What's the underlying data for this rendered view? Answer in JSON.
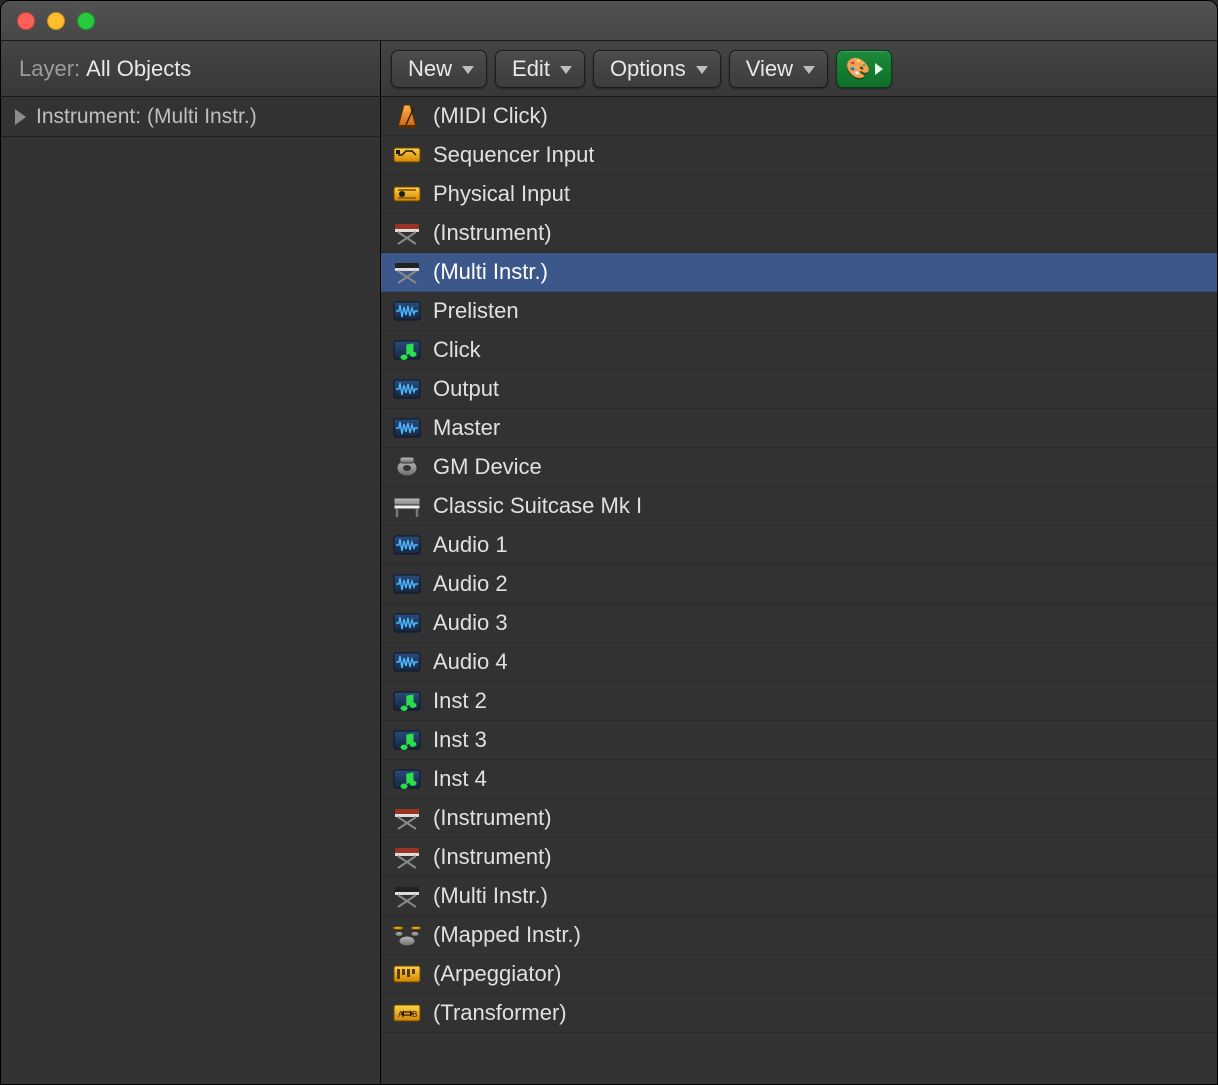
{
  "sidebar": {
    "layer_label": "Layer:",
    "layer_value": "All Objects",
    "inspector_label": "Instrument:",
    "inspector_value": "(Multi Instr.)"
  },
  "toolbar": {
    "new_label": "New",
    "edit_label": "Edit",
    "options_label": "Options",
    "view_label": "View"
  },
  "list": {
    "selected_index": 4,
    "items": [
      {
        "icon": "metronome",
        "label": "(MIDI Click)"
      },
      {
        "icon": "seq",
        "label": "Sequencer Input"
      },
      {
        "icon": "phys",
        "label": "Physical Input"
      },
      {
        "icon": "keystand",
        "label": "(Instrument)"
      },
      {
        "icon": "keystand2",
        "label": "(Multi Instr.)"
      },
      {
        "icon": "wave",
        "label": "Prelisten"
      },
      {
        "icon": "note",
        "label": "Click"
      },
      {
        "icon": "wave",
        "label": "Output"
      },
      {
        "icon": "wave",
        "label": "Master"
      },
      {
        "icon": "speaker",
        "label": "GM Device"
      },
      {
        "icon": "piano",
        "label": "Classic Suitcase Mk I"
      },
      {
        "icon": "wave",
        "label": "Audio 1"
      },
      {
        "icon": "wave",
        "label": "Audio 2"
      },
      {
        "icon": "wave",
        "label": "Audio 3"
      },
      {
        "icon": "wave",
        "label": "Audio 4"
      },
      {
        "icon": "note",
        "label": "Inst 2"
      },
      {
        "icon": "note",
        "label": "Inst 3"
      },
      {
        "icon": "note",
        "label": "Inst 4"
      },
      {
        "icon": "keystand",
        "label": "(Instrument)"
      },
      {
        "icon": "keystand",
        "label": "(Instrument)"
      },
      {
        "icon": "keystand2",
        "label": "(Multi Instr.)"
      },
      {
        "icon": "drums",
        "label": "(Mapped Instr.)"
      },
      {
        "icon": "arp",
        "label": "(Arpeggiator)"
      },
      {
        "icon": "xform",
        "label": "(Transformer)"
      }
    ]
  }
}
